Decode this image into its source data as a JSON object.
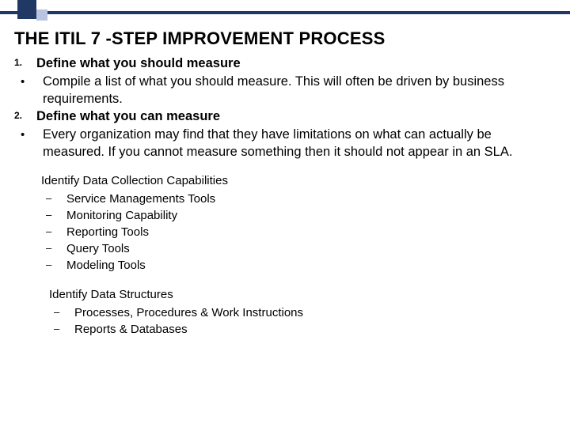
{
  "title": "THE ITIL 7 -STEP IMPROVEMENT PROCESS",
  "steps": [
    {
      "num": "1.",
      "title": "Define what you should measure",
      "bullet": "Compile a list of what you should measure. This will often be driven by business requirements."
    },
    {
      "num": "2.",
      "title": "Define what you can measure",
      "bullet": "Every organization may find that they have limitations on what can actually be measured. If you cannot measure something then it should not appear in an SLA."
    }
  ],
  "sub1": {
    "header": "Identify Data Collection Capabilities",
    "items": [
      "Service Managements Tools",
      "Monitoring Capability",
      "Reporting Tools",
      "Query Tools",
      "Modeling Tools"
    ]
  },
  "sub2": {
    "header": "Identify Data Structures",
    "items": [
      "Processes, Procedures & Work Instructions",
      "Reports & Databases"
    ]
  }
}
